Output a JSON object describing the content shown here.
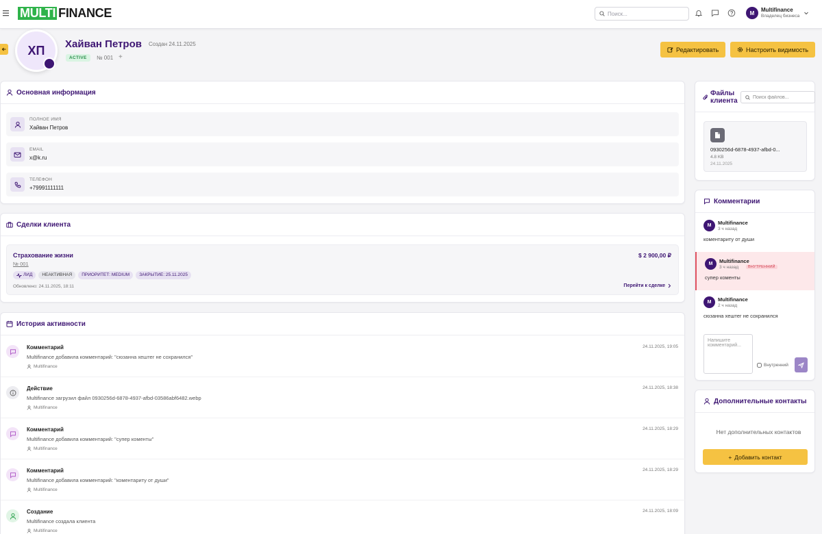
{
  "header": {
    "logo_left": "MULTI",
    "logo_right": "FINANCE",
    "search_placeholder": "Поиск...",
    "user_name": "Multifinance",
    "user_role": "Владелец бизнеса",
    "user_initial": "M"
  },
  "client": {
    "initials": "ХП",
    "name": "Хайван Петров",
    "created": "Создан 24.11.2025",
    "status": "ACTIVE",
    "number": "№ 001",
    "plus": "+",
    "edit_label": "Редактировать",
    "visibility_label": "Настроить видимость"
  },
  "basic_info": {
    "title": "Основная информация",
    "rows": [
      {
        "label": "Полное имя",
        "value": "Хайван Петров"
      },
      {
        "label": "Email",
        "value": "x@k.ru"
      },
      {
        "label": "Телефон",
        "value": "+79991111111"
      }
    ]
  },
  "deals": {
    "title": "Сделки клиента",
    "items": [
      {
        "title": "Страхование жизни",
        "number": "№ 001",
        "amount": "$ 2 900,00 ₽",
        "tags": [
          "ЛИД",
          "НЕАКТИВНАЯ",
          "ПРИОРИТЕТ: MEDIUM",
          "ЗАКРЫТИЕ: 25.11.2025"
        ],
        "updated": "Обновлено: 24.11.2025, 18:11",
        "link": "Перейти к сделке"
      }
    ]
  },
  "activity": {
    "title": "История активности",
    "items": [
      {
        "type": "Комментарий",
        "desc": "Multifinance добавила комментарий: \"сюзанна хештег не сохранился\"",
        "user": "Multifinance",
        "time": "24.11.2025, 19:05",
        "kind": "comment"
      },
      {
        "type": "Действие",
        "desc": "Multifinance загрузил файл 0930256d-6878-4937-afbd-03586abf6482.webp",
        "user": "Multifinance",
        "time": "24.11.2025, 18:38",
        "kind": "action"
      },
      {
        "type": "Комментарий",
        "desc": "Multifinance добавила комментарий: \"супер коменты\"",
        "user": "Multifinance",
        "time": "24.11.2025, 18:29",
        "kind": "comment"
      },
      {
        "type": "Комментарий",
        "desc": "Multifinance добавила комментарий: \"коментариту от души\"",
        "user": "Multifinance",
        "time": "24.11.2025, 18:29",
        "kind": "comment"
      },
      {
        "type": "Создание",
        "desc": "Multifinance создала клиента",
        "user": "Multifinance",
        "time": "24.11.2025, 18:09",
        "kind": "create"
      }
    ]
  },
  "files": {
    "title_line1": "Файлы",
    "title_line2": "клиента",
    "search_placeholder": "Поиск файлов...",
    "items": [
      {
        "name": "0930256d-6878-4937-afbd-0...",
        "size": "4.8 KB",
        "date": "24.11.2025"
      }
    ]
  },
  "comments": {
    "title": "Комментарии",
    "items": [
      {
        "author": "Multifinance",
        "time": "3 ч назад",
        "text": "коментариту от души",
        "internal": false,
        "initial": "M"
      },
      {
        "author": "Multifinance",
        "time": "3 ч назад",
        "text": "супер коменты",
        "internal": true,
        "internal_label": "ВНУТРЕННИЙ",
        "initial": "M"
      },
      {
        "author": "Multifinance",
        "time": "2 ч назад",
        "text": "сюзанна хештег не сохранился",
        "internal": false,
        "initial": "M"
      }
    ],
    "input_placeholder": "Напишите комментарий...",
    "internal_checkbox_label": "Внутренний"
  },
  "contacts": {
    "title": "Дополнительные контакты",
    "empty": "Нет дополнительных контактов",
    "add_label": "Добавить контакт",
    "add_plus": "+"
  },
  "colors": {
    "brand_green": "#2fb34a",
    "primary_purple": "#3e1673",
    "accent_yellow": "#f5c242",
    "internal_red": "#e05260"
  }
}
